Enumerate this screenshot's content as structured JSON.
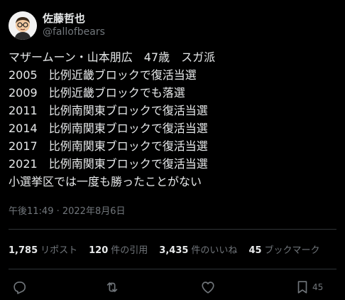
{
  "author": {
    "display_name": "佐藤哲也",
    "handle": "@fallofbears",
    "avatar_icon": "cartoon-avatar-icon"
  },
  "tweet": {
    "lines": [
      "マザームーン・山本朋広　47歳　スガ派",
      "2005　比例近畿ブロックで復活当選",
      "2009　比例近畿ブロックでも落選",
      "2011　比例南関東ブロックで復活当選",
      "2014　比例南関東ブロックで復活当選",
      "2017　比例南関東ブロックで復活当選",
      "2021　比例南関東ブロックで復活当選",
      "小選挙区では一度も勝ったことがない"
    ],
    "timestamp": "午後11:49 · 2022年8月6日"
  },
  "stats": {
    "retweets": {
      "count": "1,785",
      "label": "リポスト"
    },
    "quotes": {
      "count": "120",
      "label": "件の引用"
    },
    "likes": {
      "count": "3,435",
      "label": "件のいいね"
    },
    "bookmarks": {
      "count": "45",
      "label": "ブックマーク"
    }
  },
  "actions": {
    "reply_icon": "reply-icon",
    "retweet_icon": "retweet-icon",
    "like_icon": "heart-icon",
    "bookmark_icon": "bookmark-icon",
    "bookmark_count": "45"
  },
  "colors": {
    "background": "#000000",
    "text": "#e7e9ea",
    "secondary": "#71767b",
    "divider": "#2f3336"
  }
}
